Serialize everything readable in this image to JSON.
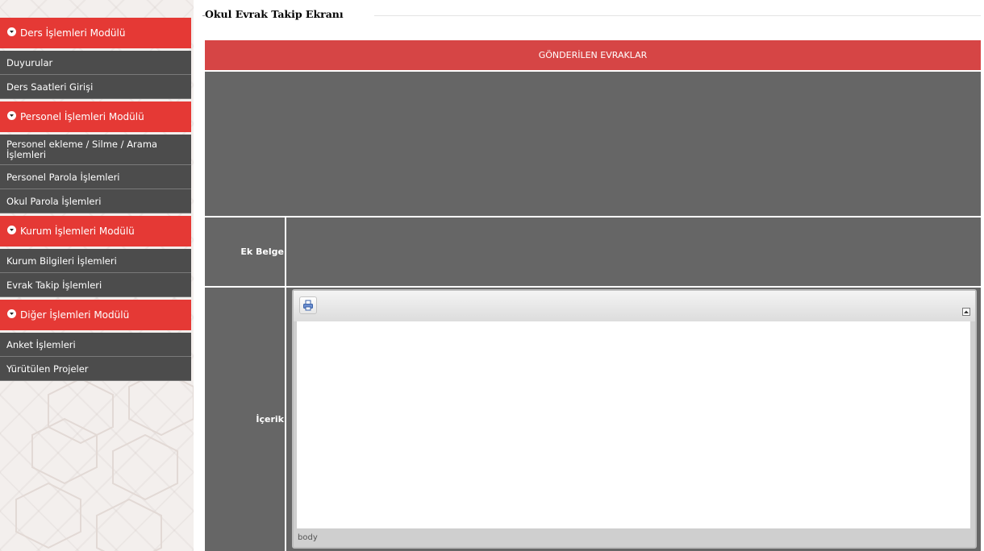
{
  "sidebar": {
    "modules": [
      {
        "label": "Ders İşlemleri Modülü",
        "items": [
          "Duyurular",
          "Ders Saatleri Girişi"
        ]
      },
      {
        "label": "Personel İşlemleri Modülü",
        "items": [
          "Personel ekleme / Silme / Arama İşlemleri",
          "Personel Parola İşlemleri",
          "Okul Parola İşlemleri"
        ]
      },
      {
        "label": "Kurum İşlemleri Modülü",
        "items": [
          "Kurum Bilgileri İşlemleri",
          "Evrak Takip İşlemleri"
        ]
      },
      {
        "label": "Diğer İşlemleri Modülü",
        "items": [
          "Anket İşlemleri",
          "Yürütülen Projeler"
        ]
      }
    ]
  },
  "main": {
    "title": "Okul Evrak Takip Ekranı",
    "header": "GÖNDERİLEN EVRAKLAR",
    "attachment_label": "Ek Belge",
    "content_label": "İçerik",
    "editor": {
      "status_path": "body",
      "print_icon": "print-icon",
      "collapse_icon": "collapse-toolbar-icon"
    }
  },
  "colors": {
    "module_red": "#e53935",
    "header_red": "#d64545",
    "menu_item_bg": "#4c4c4c",
    "panel_gray": "#666666"
  }
}
